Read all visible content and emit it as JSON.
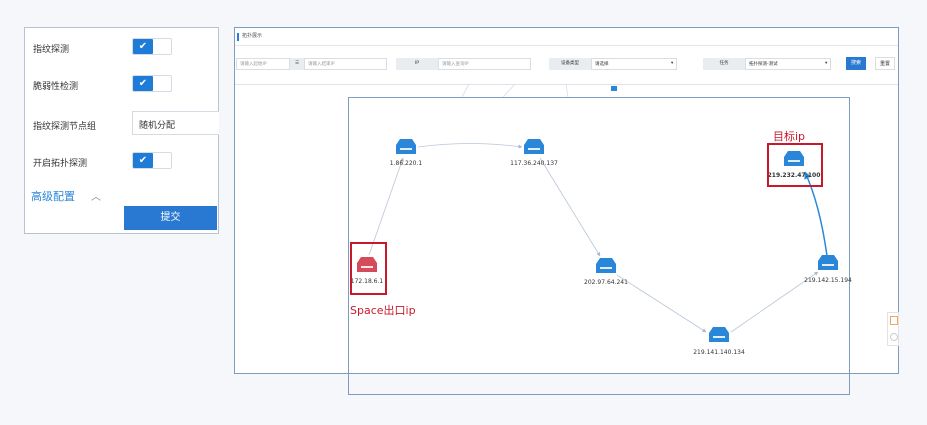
{
  "settings": {
    "rows": [
      {
        "label": "指纹探测",
        "type": "toggle",
        "on": true
      },
      {
        "label": "脆弱性检测",
        "type": "toggle",
        "on": true
      },
      {
        "label": "指纹探测节点组",
        "type": "select",
        "value": "随机分配"
      },
      {
        "label": "开启拓扑探测",
        "type": "toggle",
        "on": true
      }
    ],
    "advanced_label": "高级配置",
    "submit_label": "提交"
  },
  "window": {
    "title": "拓扑展示",
    "filters": {
      "start_ip_placeholder": "请输入起始IP",
      "range_sep": "☰",
      "end_ip_placeholder": "请输入结束IP",
      "ip_label": "IP",
      "ip_placeholder": "请输入查询IP",
      "device_type_label": "设备类型",
      "device_type_value": "请选择",
      "task_label": "任务",
      "task_value": "拓扑探测-测试",
      "search_label": "搜索",
      "reset_label": "重置"
    }
  },
  "topology": {
    "nodes": [
      {
        "id": "n1",
        "ip": "1.86.220.1",
        "highlight": false
      },
      {
        "id": "n2",
        "ip": "117.36.240.137",
        "highlight": false
      },
      {
        "id": "n3",
        "ip": "172.18.6.1",
        "highlight": true
      },
      {
        "id": "n4",
        "ip": "202.97.64.241",
        "highlight": false
      },
      {
        "id": "n5",
        "ip": "219.141.140.134",
        "highlight": false
      },
      {
        "id": "n6",
        "ip": "219.142.15.194",
        "highlight": false
      },
      {
        "id": "n7",
        "ip": "219.232.47.100",
        "highlight": true
      }
    ],
    "edges": [
      [
        "n3",
        "n1"
      ],
      [
        "n1",
        "n2"
      ],
      [
        "n2",
        "n4"
      ],
      [
        "n4",
        "n5"
      ],
      [
        "n5",
        "n6"
      ],
      [
        "n6",
        "n7"
      ]
    ],
    "annotations": {
      "source": "Space出口ip",
      "target": "目标ip"
    }
  },
  "colors": {
    "accent": "#1f7bd8",
    "node": "#2a86d8",
    "node_alert": "#d64a5a",
    "highlight": "#c8192c"
  },
  "icons": {
    "device": "router-icon",
    "collapse": "chevron-up-icon",
    "check": "check-icon"
  }
}
